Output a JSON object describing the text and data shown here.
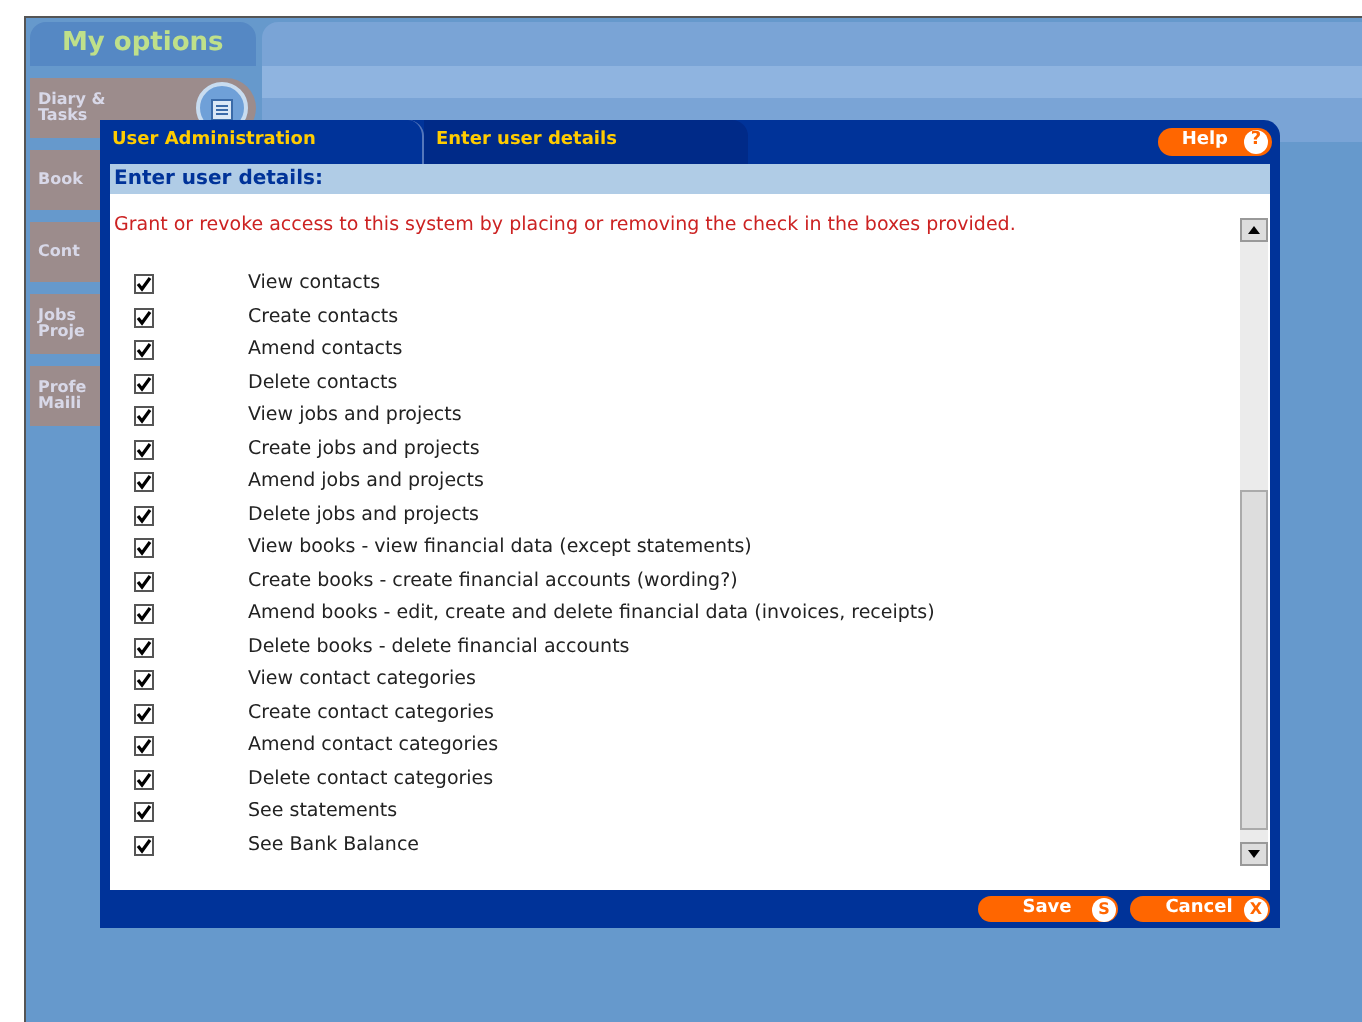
{
  "sidebar": {
    "title": "My options",
    "items": [
      {
        "label": "Diary & Tasks",
        "kind": "with-icon"
      },
      {
        "label": "Book",
        "kind": "plain"
      },
      {
        "label": "Cont",
        "kind": "plain"
      },
      {
        "label": "Jobs Proje",
        "kind": "plain"
      },
      {
        "label": "Profe Maili",
        "kind": "plain"
      }
    ]
  },
  "dialog": {
    "tabs": [
      {
        "label": "User Administration",
        "selected": true
      },
      {
        "label": "Enter user details",
        "selected": false
      }
    ],
    "help": "Help",
    "help_icon": "?",
    "heading": "Enter user details:",
    "instruction": "Grant or revoke access to this system by placing or removing the check in the boxes provided.",
    "permissions": [
      {
        "label": "View contacts",
        "checked": true
      },
      {
        "label": "Create contacts",
        "checked": true
      },
      {
        "label": "Amend contacts",
        "checked": true
      },
      {
        "label": "Delete contacts",
        "checked": true
      },
      {
        "label": "View jobs and projects",
        "checked": true
      },
      {
        "label": "Create jobs and projects",
        "checked": true
      },
      {
        "label": "Amend jobs and projects",
        "checked": true
      },
      {
        "label": "Delete jobs and projects",
        "checked": true
      },
      {
        "label": "View books - view financial data (except statements)",
        "checked": true
      },
      {
        "label": "Create books - create financial accounts (wording?)",
        "checked": true
      },
      {
        "label": "Amend books - edit, create and delete financial data (invoices, receipts)",
        "checked": true
      },
      {
        "label": "Delete books - delete financial accounts",
        "checked": true
      },
      {
        "label": "View contact categories",
        "checked": true
      },
      {
        "label": "Create contact categories",
        "checked": true
      },
      {
        "label": "Amend contact categories",
        "checked": true
      },
      {
        "label": "Delete contact categories",
        "checked": true
      },
      {
        "label": "See statements",
        "checked": true
      },
      {
        "label": "See Bank Balance",
        "checked": true
      }
    ],
    "buttons": [
      {
        "label": "Save",
        "key": "S"
      },
      {
        "label": "Cancel",
        "key": "X"
      }
    ]
  }
}
